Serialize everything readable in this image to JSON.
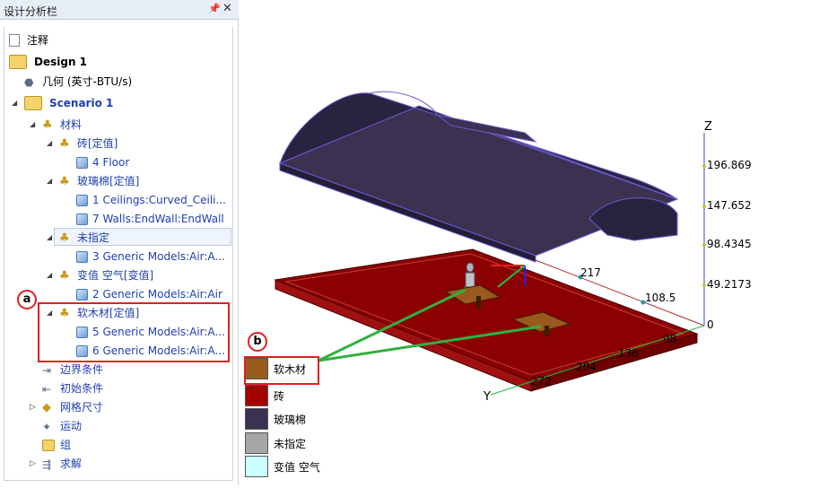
{
  "pane": {
    "title": "设计分析栏",
    "pin_glyph": "📌",
    "close_glyph": "✕"
  },
  "tree": {
    "notes": "注释",
    "design": "Design 1",
    "geometry": "几何 (英寸-BTU/s)",
    "scenario": "Scenario 1",
    "materials": "材料",
    "brick": "砖[定值]",
    "brick_child": "4 Floor",
    "glasswool": "玻璃棉[定值]",
    "glasswool_child1": "1 Ceilings:Curved_Ceili...",
    "glasswool_child2": "7 Walls:EndWall:EndWall",
    "unassigned": "未指定",
    "unassigned_child": "3 Generic Models:Air:A...",
    "variable_air": "变值 空气[变值]",
    "variable_air_child": "2 Generic Models:Air:Air",
    "cork": "软木材[定值]",
    "cork_child1": "5 Generic Models:Air:A...",
    "cork_child2": "6 Generic Models:Air:A...",
    "boundary": "边界条件",
    "initial": "初始条件",
    "mesh": "网格尺寸",
    "motion": "运动",
    "group": "组",
    "solve": "求解"
  },
  "badges": {
    "a": "a",
    "b": "b"
  },
  "axes": {
    "z_label": "Z",
    "y_label": "Y",
    "z_ticks": [
      "196.869",
      "147.652",
      "98.4345",
      "49.2173",
      "0"
    ],
    "x_ticks": [
      "217",
      "108.5"
    ],
    "y_ticks": [
      "98",
      "136",
      "204",
      "272"
    ]
  },
  "legend": [
    {
      "label": "软木材",
      "color": "#9a5a1e"
    },
    {
      "label": "砖",
      "color": "#a50000"
    },
    {
      "label": "玻璃棉",
      "color": "#3b3150"
    },
    {
      "label": "未指定",
      "color": "#a6a6a6"
    },
    {
      "label": "变值 空气",
      "color": "#ccffff"
    }
  ],
  "colors": {
    "accent_red": "#e02020",
    "tree_blue": "#1f3fb0"
  }
}
